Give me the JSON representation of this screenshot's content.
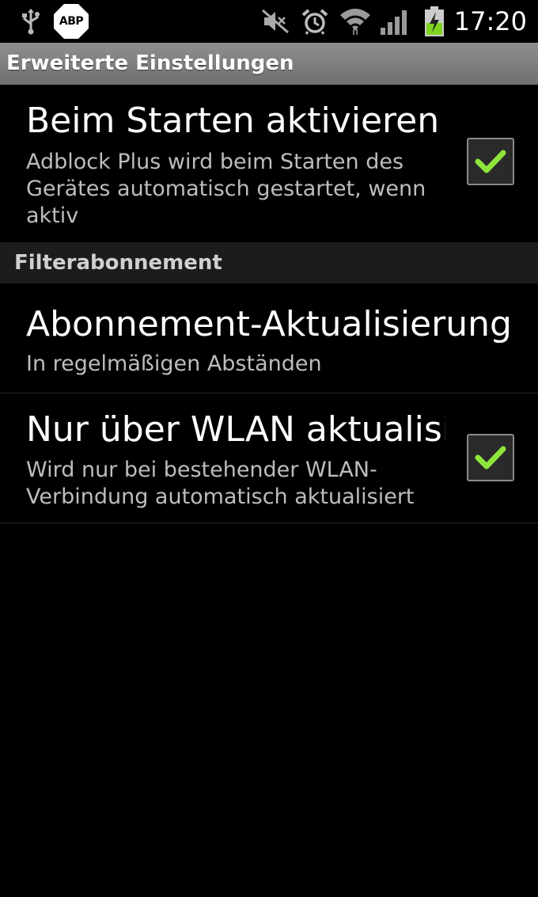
{
  "status_bar": {
    "time": "17:20",
    "abp_badge": "ABP",
    "icons": [
      "usb-icon",
      "abp-icon",
      "mute-icon",
      "alarm-icon",
      "wifi-icon",
      "signal-icon",
      "battery-charging-icon"
    ],
    "battery_color": "#7ed321"
  },
  "title_bar": {
    "title": "Erweiterte Einstellungen"
  },
  "preferences": [
    {
      "title": "Beim Starten aktivieren",
      "summary_lines": [
        "Adblock Plus wird beim Starten des",
        "Gerätes automatisch gestartet, wenn",
        "aktiv"
      ],
      "checked": true
    }
  ],
  "category": {
    "title": "Filterabonnement"
  },
  "filter_preferences": [
    {
      "title": "Abonnement-Aktualisierung",
      "summary_lines": [
        "In regelmäßigen Abständen"
      ]
    },
    {
      "title": "Nur über WLAN aktualisieren",
      "summary_lines": [
        "Wird nur bei bestehender WLAN-",
        "Verbindung automatisch aktualisiert"
      ],
      "checked": true
    }
  ],
  "colors": {
    "check": "#8ee63c",
    "title_bar": "#7f7f7f",
    "category_bg": "#1c1c1c"
  }
}
